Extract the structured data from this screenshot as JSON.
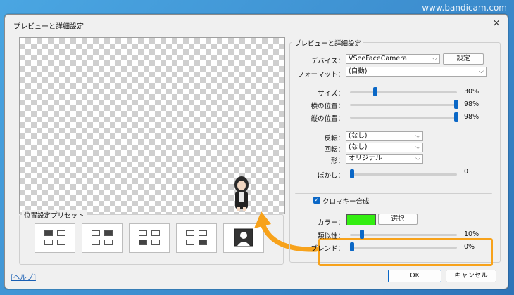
{
  "watermark": "www.bandicam.com",
  "dialog": {
    "title": "プレビューと詳細設定",
    "close_icon": "×"
  },
  "preset": {
    "label": "位置設定プリセット",
    "items": [
      {
        "name": "Layout 1",
        "active_cell": "top-left"
      },
      {
        "name": "Layout 2",
        "active_cell": "top-right"
      },
      {
        "name": "Layout 3",
        "active_cell": "bottom-left"
      },
      {
        "name": "Layout 4",
        "active_cell": "bottom-right"
      },
      {
        "name": "Layout 5",
        "active_cell": "fullscreen"
      }
    ]
  },
  "settings": {
    "group_label": "プレビューと詳細設定",
    "device_label": "デバイス：",
    "device_value": "VSeeFaceCamera",
    "settings_button": "設定",
    "format_label": "フォーマット：",
    "format_value": "(自動)",
    "size_label": "サイズ：",
    "size_value": "30%",
    "hpos_label": "横の位置：",
    "hpos_value": "98%",
    "vpos_label": "縦の位置：",
    "vpos_value": "98%",
    "flip_label": "反転：",
    "flip_value": "(なし)",
    "rotate_label": "回転：",
    "rotate_value": "(なし)",
    "shape_label": "形：",
    "shape_value": "オリジナル",
    "blur_label": "ぼかし：",
    "blur_value": "0"
  },
  "chroma": {
    "checkbox_label": "クロマキー合成",
    "checked": true,
    "color_label": "カラー：",
    "color_hex": "#33ee11",
    "select_button": "選択",
    "similarity_label": "類似性：",
    "similarity_value": "10%",
    "blend_label": "ブレンド：",
    "blend_value": "0%"
  },
  "footer": {
    "help_link": "[ヘルプ]",
    "ok_button": "OK",
    "cancel_button": "キャンセル"
  },
  "colors": {
    "accent": "#0a67c6",
    "highlight": "#f7a21b"
  }
}
